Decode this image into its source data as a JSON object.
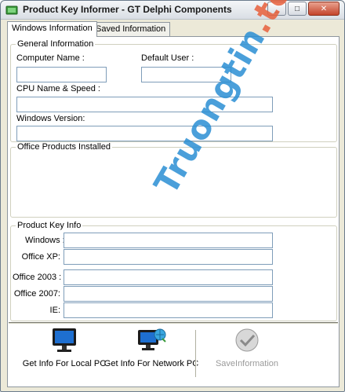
{
  "window": {
    "title": "Product Key Informer - GT Delphi Components",
    "minimize_glyph": "_",
    "maximize_glyph": "□",
    "close_glyph": "✕"
  },
  "tabs": [
    {
      "label": "Windows Information",
      "active": true
    },
    {
      "label": "Saved Information",
      "active": false
    }
  ],
  "general": {
    "title": "General Information",
    "computer_name_label": "Computer Name :",
    "computer_name_value": "",
    "default_user_label": "Default User :",
    "default_user_value": "",
    "cpu_label": "CPU Name & Speed :",
    "cpu_value": "",
    "windows_version_label": "Windows Version:",
    "windows_version_value": ""
  },
  "office": {
    "title": "Office Products Installed"
  },
  "product_keys": {
    "title": "Product Key Info",
    "rows": [
      {
        "label": "Windows :",
        "value": ""
      },
      {
        "label": "Office XP:",
        "value": ""
      },
      {
        "label": "Office 2003 :",
        "value": ""
      },
      {
        "label": "Office 2007:",
        "value": ""
      },
      {
        "label": "IE:",
        "value": ""
      }
    ]
  },
  "actions": [
    {
      "label": "Get Info For Local PC",
      "icon": "monitor-icon",
      "enabled": true
    },
    {
      "label": "Get Info For Network PC",
      "icon": "network-monitor-icon",
      "enabled": true
    },
    {
      "label": "SaveInformation",
      "icon": "save-check-icon",
      "enabled": false
    }
  ],
  "watermark": {
    "part1": "Truongtin",
    "part2": ".top"
  },
  "colors": {
    "field_border": "#7f9db9",
    "window_bg": "#ece9d8",
    "watermark_blue": "#2b8fd4",
    "watermark_orange": "#e8603c"
  }
}
